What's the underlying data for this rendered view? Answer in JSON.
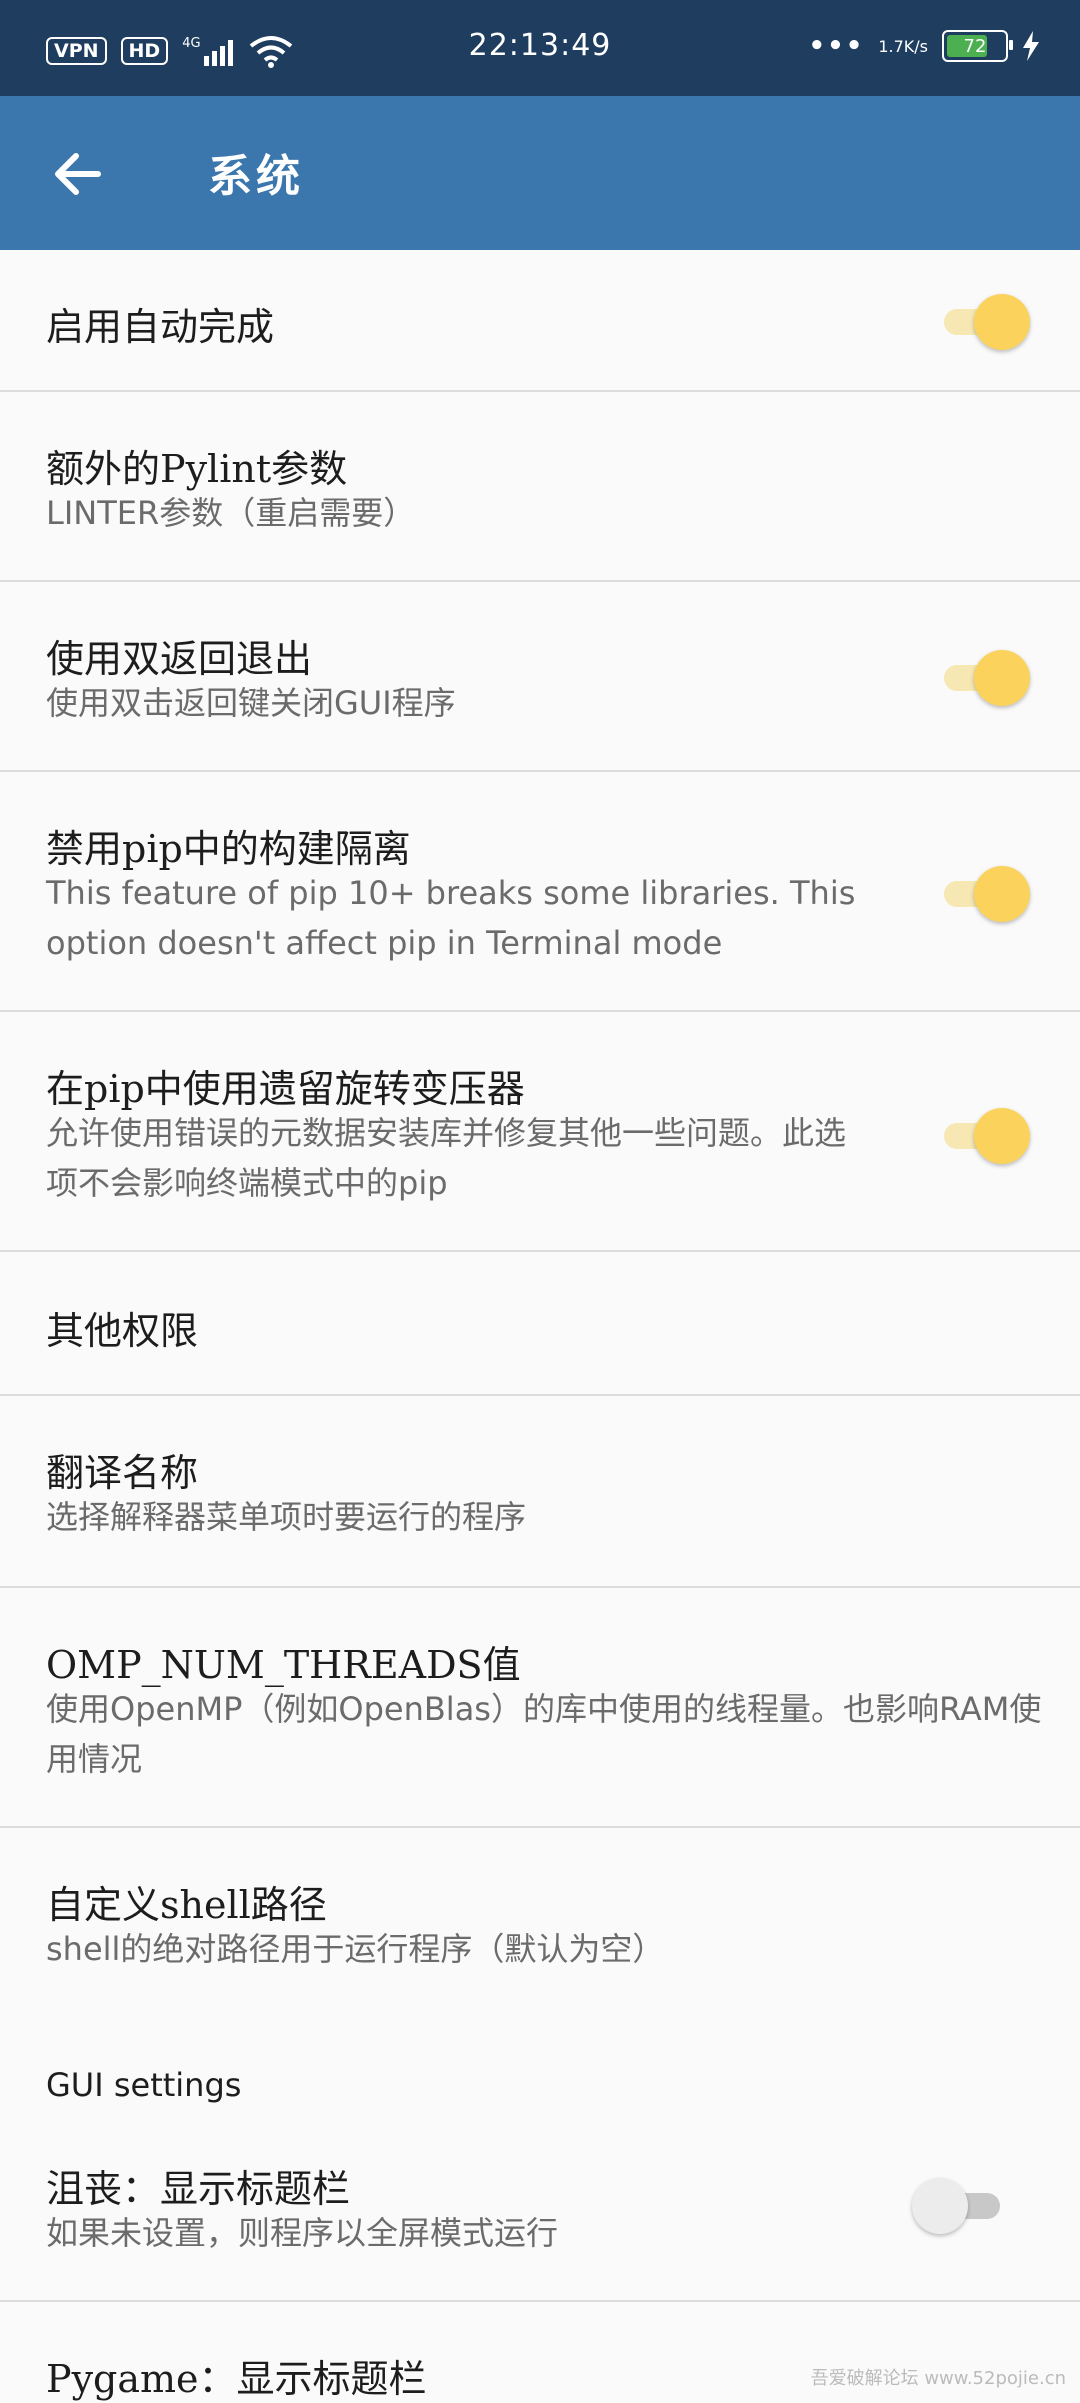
{
  "status_bar": {
    "vpn": "VPN",
    "hd": "HD",
    "network": "4G",
    "time": "22:13:49",
    "speed": "1.7K/s",
    "battery": "72",
    "battery_level": 0.72
  },
  "app_bar": {
    "title": "系统"
  },
  "prefs": [
    {
      "title": "启用自动完成",
      "switch": "on"
    },
    {
      "title": "额外的Pylint参数",
      "summary": "LINTER参数（重启需要）"
    },
    {
      "title": "使用双返回退出",
      "summary": "使用双击返回键关闭GUI程序",
      "switch": "on"
    },
    {
      "title": "禁用pip中的构建隔离",
      "summary": "This feature of pip 10+ breaks some libraries. This option doesn't affect pip in Terminal mode",
      "switch": "on"
    },
    {
      "title": "在pip中使用遗留旋转变压器",
      "summary": "允许使用错误的元数据安装库并修复其他一些问题。此选项不会影响终端模式中的pip",
      "switch": "on"
    },
    {
      "title": "其他权限"
    },
    {
      "title": "翻译名称",
      "summary": "选择解释器菜单项时要运行的程序"
    },
    {
      "title": "OMP_NUM_THREADS值",
      "summary": "使用OpenMP（例如OpenBlas）的库中使用的线程量。也影响RAM使用情况"
    },
    {
      "title": "自定义shell路径",
      "summary": "shell的绝对路径用于运行程序（默认为空）"
    }
  ],
  "gui_section": {
    "header": "GUI settings",
    "items": [
      {
        "title": "沮丧：显示标题栏",
        "summary": "如果未设置，则程序以全屏模式运行",
        "switch": "off"
      },
      {
        "title": "Pygame：显示标题栏"
      }
    ]
  },
  "watermark": "吾爱破解论坛 www.52pojie.cn",
  "colors": {
    "status_bar": "#1f3e5f",
    "app_bar": "#3b76ad",
    "switch_on": "#fbd35c"
  }
}
